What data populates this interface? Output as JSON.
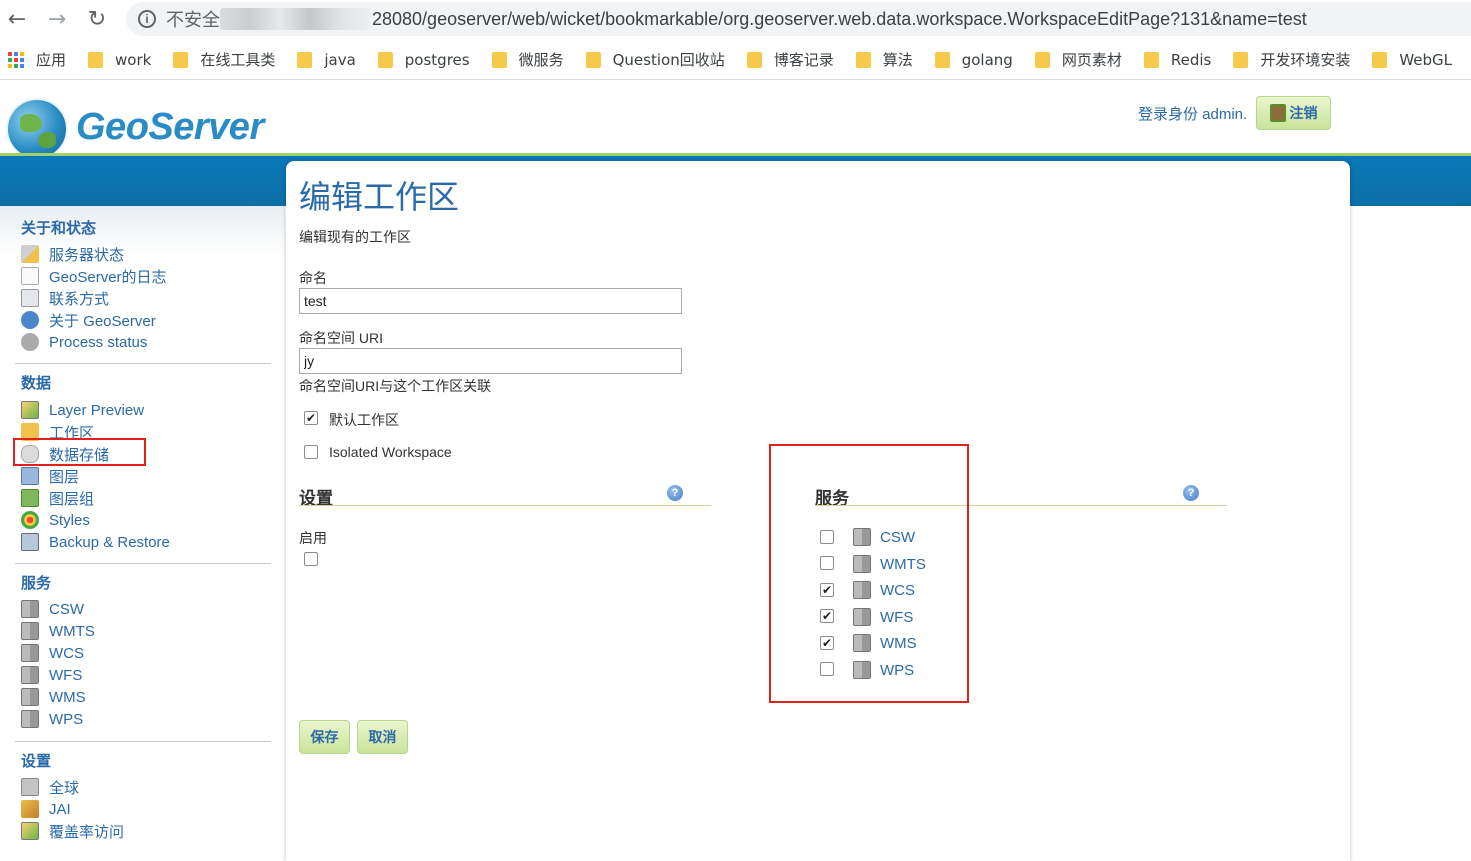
{
  "browser": {
    "address_insecure": "不安全",
    "address_url": "28080/geoserver/web/wicket/bookmarkable/org.geoserver.web.data.workspace.WorkspaceEditPage?131&name=test",
    "bookmarks": [
      "应用",
      "work",
      "在线工具类",
      "java",
      "postgres",
      "微服务",
      "Question回收站",
      "博客记录",
      "算法",
      "golang",
      "网页素材",
      "Redis",
      "开发环境安装",
      "WebGL"
    ]
  },
  "header": {
    "logo_text": "GeoServer",
    "login_text": "登录身份 admin.",
    "logout_label": "注销"
  },
  "sidebar": {
    "about": {
      "title": "关于和状态",
      "items": [
        "服务器状态",
        "GeoServer的日志",
        "联系方式",
        "关于 GeoServer",
        "Process status"
      ]
    },
    "data": {
      "title": "数据",
      "items": [
        "Layer Preview",
        "工作区",
        "数据存储",
        "图层",
        "图层组",
        "Styles",
        "Backup & Restore"
      ]
    },
    "services": {
      "title": "服务",
      "items": [
        "CSW",
        "WMTS",
        "WCS",
        "WFS",
        "WMS",
        "WPS"
      ]
    },
    "settings": {
      "title": "设置",
      "items": [
        "全球",
        "JAI",
        "覆盖率访问"
      ]
    }
  },
  "main": {
    "title": "编辑工作区",
    "description": "编辑现有的工作区",
    "name_label": "命名",
    "name_value": "test",
    "uri_label": "命名空间 URI",
    "uri_value": "jy",
    "uri_help": "命名空间URI与这个工作区关联",
    "default_ws_label": "默认工作区",
    "default_ws_checked": true,
    "isolated_label": "Isolated Workspace",
    "isolated_checked": false,
    "settings_section": {
      "title": "设置",
      "enable_label": "启用",
      "enable_checked": false
    },
    "services_section": {
      "title": "服务",
      "services": [
        {
          "name": "CSW",
          "checked": false
        },
        {
          "name": "WMTS",
          "checked": false
        },
        {
          "name": "WCS",
          "checked": true
        },
        {
          "name": "WFS",
          "checked": true
        },
        {
          "name": "WMS",
          "checked": true
        },
        {
          "name": "WPS",
          "checked": false
        }
      ]
    },
    "save_label": "保存",
    "cancel_label": "取消"
  },
  "colors": {
    "link": "#2b6aa8",
    "band": "#0a78b8",
    "button_green": "#c9e39a",
    "highlight_red": "#e0221c"
  }
}
